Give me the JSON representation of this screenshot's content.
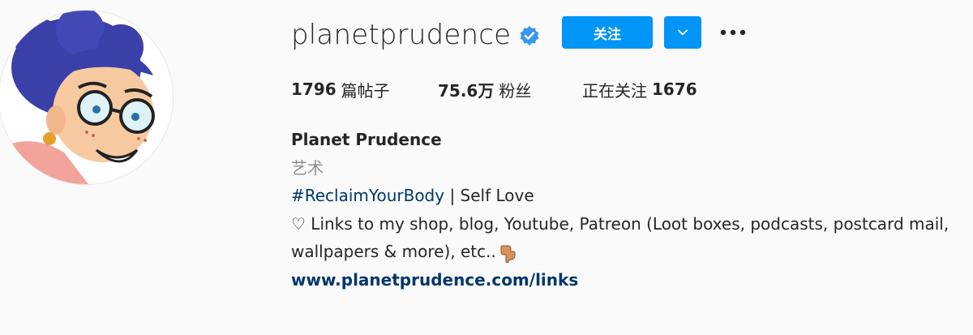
{
  "profile": {
    "username": "planetprudence",
    "verified": true,
    "follow_label": "关注",
    "stats": {
      "posts_count": "1796",
      "posts_label": "篇帖子",
      "followers_count": "75.6万",
      "followers_label": "粉丝",
      "following_label": "正在关注",
      "following_count": "1676"
    },
    "bio": {
      "full_name": "Planet Prudence",
      "category": "艺术",
      "hashtag": "#ReclaimYourBody",
      "hashtag_suffix": " | Self Love",
      "heart": "♡",
      "line3": " Links to my shop, blog, Youtube, Patreon (Loot boxes, podcasts, postcard mail,",
      "line4": "wallpapers & more), etc..",
      "website": "www.planetprudence.com/links"
    }
  },
  "colors": {
    "accent": "#0095f6",
    "text": "#262626",
    "secondary": "#8e8e8e",
    "link": "#00376b",
    "background": "#fafafa"
  },
  "icons": {
    "verified": "verified-badge-icon",
    "dropdown": "chevron-down-icon",
    "more": "more-options-icon",
    "pointer": "pointing-down-hand-icon"
  }
}
